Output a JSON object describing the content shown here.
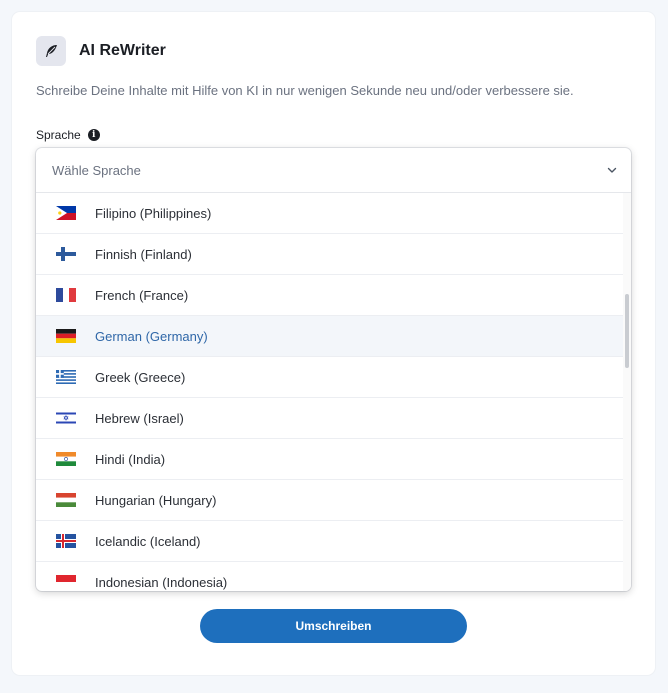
{
  "app": {
    "title": "AI ReWriter",
    "subtitle": "Schreibe Deine Inhalte mit Hilfe von KI in nur wenigen Sekunde neu und/oder verbessere sie.",
    "icon": "quill-icon"
  },
  "language_field": {
    "label": "Sprache",
    "info_glyph": "i",
    "placeholder": "Wähle Sprache",
    "options": [
      {
        "label": "Filipino (Philippines)",
        "flag": "philippines-flag-icon"
      },
      {
        "label": "Finnish (Finland)",
        "flag": "finland-flag-icon"
      },
      {
        "label": "French (France)",
        "flag": "france-flag-icon"
      },
      {
        "label": "German (Germany)",
        "flag": "germany-flag-icon",
        "selected": true
      },
      {
        "label": "Greek (Greece)",
        "flag": "greece-flag-icon"
      },
      {
        "label": "Hebrew (Israel)",
        "flag": "israel-flag-icon"
      },
      {
        "label": "Hindi (India)",
        "flag": "india-flag-icon"
      },
      {
        "label": "Hungarian (Hungary)",
        "flag": "hungary-flag-icon"
      },
      {
        "label": "Icelandic (Iceland)",
        "flag": "iceland-flag-icon"
      },
      {
        "label": "Indonesian (Indonesia)",
        "flag": "indonesia-flag-icon"
      }
    ]
  },
  "submit": {
    "label": "Umschreiben"
  },
  "colors": {
    "accent": "#1e6fbd",
    "selected_text": "#2f67a8",
    "selected_bg": "#f3f6fa"
  }
}
